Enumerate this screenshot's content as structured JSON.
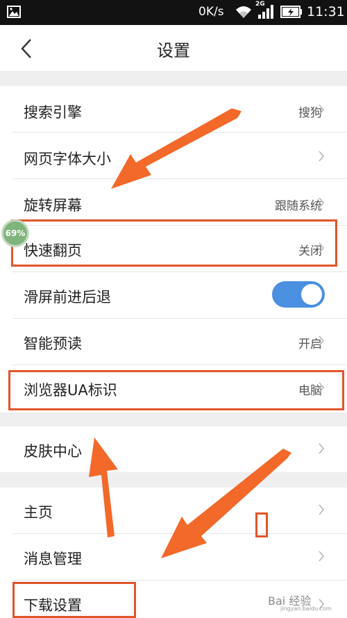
{
  "status": {
    "speed": "0K/s",
    "network": "2G",
    "time": "11:31"
  },
  "header": {
    "title": "设置"
  },
  "settings": [
    {
      "label": "搜索引擎",
      "value": "搜狗"
    },
    {
      "label": "网页字体大小",
      "value": ""
    },
    {
      "label": "旋转屏幕",
      "value": "跟随系统"
    },
    {
      "label": "快速翻页",
      "value": "关闭"
    },
    {
      "label": "滑屏前进后退",
      "value": ""
    },
    {
      "label": "智能预读",
      "value": "开启"
    },
    {
      "label": "浏览器UA标识",
      "value": "电脑"
    },
    {
      "label": "皮肤中心",
      "value": ""
    },
    {
      "label": "主页",
      "value": ""
    },
    {
      "label": "消息管理",
      "value": ""
    },
    {
      "label": "下载设置",
      "value": ""
    }
  ],
  "overlay": {
    "badge": "69%",
    "watermark": "Bai 经验",
    "watermark_sub": "jingyan.baidu.com"
  },
  "colors": {
    "accent": "#4a8fe0",
    "annotation": "#e0552a",
    "status_bar": "#121212"
  },
  "toggles": {
    "swipe_nav_on": true
  }
}
